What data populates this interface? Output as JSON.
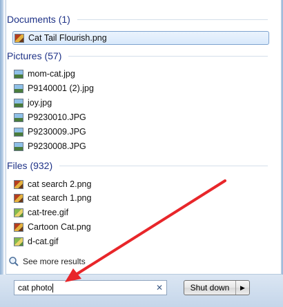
{
  "groups": {
    "documents": {
      "header": "Documents (1)",
      "items": [
        {
          "label": "Cat Tail Flourish.png",
          "icon": "png-image-icon"
        }
      ]
    },
    "pictures": {
      "header": "Pictures (57)",
      "items": [
        {
          "label": "mom-cat.jpg",
          "icon": "jpg-image-icon"
        },
        {
          "label": "P9140001 (2).jpg",
          "icon": "jpg-image-icon"
        },
        {
          "label": "joy.jpg",
          "icon": "jpg-image-icon"
        },
        {
          "label": "P9230010.JPG",
          "icon": "jpg-image-icon"
        },
        {
          "label": "P9230009.JPG",
          "icon": "jpg-image-icon"
        },
        {
          "label": "P9230008.JPG",
          "icon": "jpg-image-icon"
        }
      ]
    },
    "files": {
      "header": "Files (932)",
      "items": [
        {
          "label": "cat search 2.png",
          "icon": "png-image-icon"
        },
        {
          "label": "cat search 1.png",
          "icon": "png-image-icon"
        },
        {
          "label": "cat-tree.gif",
          "icon": "gif-image-icon"
        },
        {
          "label": "Cartoon Cat.png",
          "icon": "png-image-icon"
        },
        {
          "label": "d-cat.gif",
          "icon": "gif-image-icon"
        }
      ]
    }
  },
  "see_more": {
    "label": "See more results",
    "icon": "magnifier-icon"
  },
  "search": {
    "value": "cat photo",
    "clear_icon": "clear-x-icon"
  },
  "shutdown": {
    "label": "Shut down",
    "arrow_icon": "triangle-right-icon"
  },
  "colors": {
    "header": "#1e3287",
    "annotation_arrow": "#e8262a"
  }
}
